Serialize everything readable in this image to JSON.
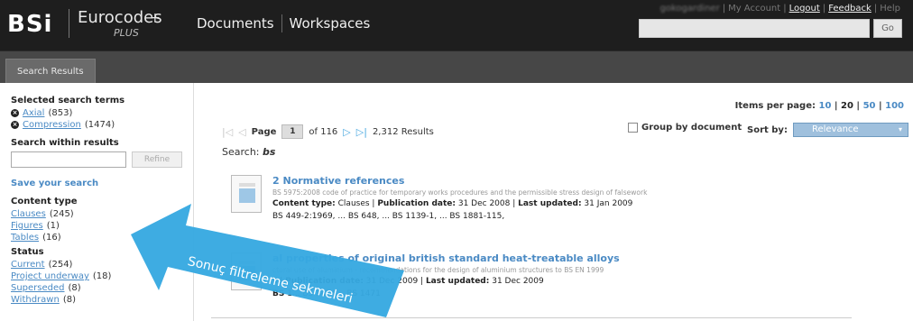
{
  "header": {
    "logo": "BSi",
    "product": "Eurocodes",
    "product_plus": "+",
    "product_sub": "PLUS",
    "nav": [
      "Documents",
      "Workspaces"
    ],
    "user_links": {
      "username": "gokogardiner",
      "my_account": "My Account",
      "logout": "Logout",
      "feedback": "Feedback",
      "help": "Help"
    },
    "go_label": "Go"
  },
  "tabs": {
    "active": "Search Results"
  },
  "sidebar": {
    "selected_heading": "Selected search terms",
    "selected_terms": [
      {
        "label": "Axial",
        "count": "(853)"
      },
      {
        "label": "Compression",
        "count": "(1474)"
      }
    ],
    "within_heading": "Search within results",
    "refine_label": "Refine",
    "save_search": "Save your search",
    "content_type_heading": "Content type",
    "content_types": [
      {
        "label": "Clauses",
        "count": "(245)"
      },
      {
        "label": "Figures",
        "count": "(1)"
      },
      {
        "label": "Tables",
        "count": "(16)"
      }
    ],
    "status_heading": "Status",
    "statuses": [
      {
        "label": "Current",
        "count": "(254)"
      },
      {
        "label": "Project underway",
        "count": "(18)"
      },
      {
        "label": "Superseded",
        "count": "(8)"
      },
      {
        "label": "Withdrawn",
        "count": "(8)"
      }
    ]
  },
  "main": {
    "items_per_page_label": "Items per page:",
    "items_per_page": [
      "10",
      "20",
      "50",
      "100"
    ],
    "items_per_page_current": "20",
    "page_label": "Page",
    "page_current": "1",
    "page_of": "of 116",
    "results_count": "2,312 Results",
    "group_by": "Group by document",
    "sort_by": "Sort by:",
    "sort_value": "Relevance",
    "search_label": "Search:",
    "search_term": "bs",
    "results": [
      {
        "title": "2 Normative references",
        "desc": "BS 5975:2008 code of practice for temporary works procedures and the permissible stress design of falsework",
        "content_type_label": "Content type:",
        "content_type": "Clauses",
        "pub_label": "Publication date:",
        "pub_date": "31 Dec 2008",
        "upd_label": "Last updated:",
        "upd_date": "31 Jan 2009",
        "refs": "BS 449-2:1969, ... BS 648, ... BS 1139-1, ... BS 1881-115,"
      },
      {
        "title": "al properties of original british standard heat-treatable alloys",
        "desc": "ctural use of aluminium - recommendations for the design of aluminium structures to BS EN 1999",
        "content_type_label": "s",
        "content_type": "",
        "pub_label": "Publication date:",
        "pub_date": "31 Dec 2009",
        "upd_label": "Last updated:",
        "upd_date": "31 Dec 2009",
        "refs_prefix": "BS",
        "refs": "1... BS 1474... BS 1471"
      }
    ]
  },
  "annotation": {
    "text": "Sonuç filtreleme sekmeleri",
    "color": "#36a9e1"
  }
}
